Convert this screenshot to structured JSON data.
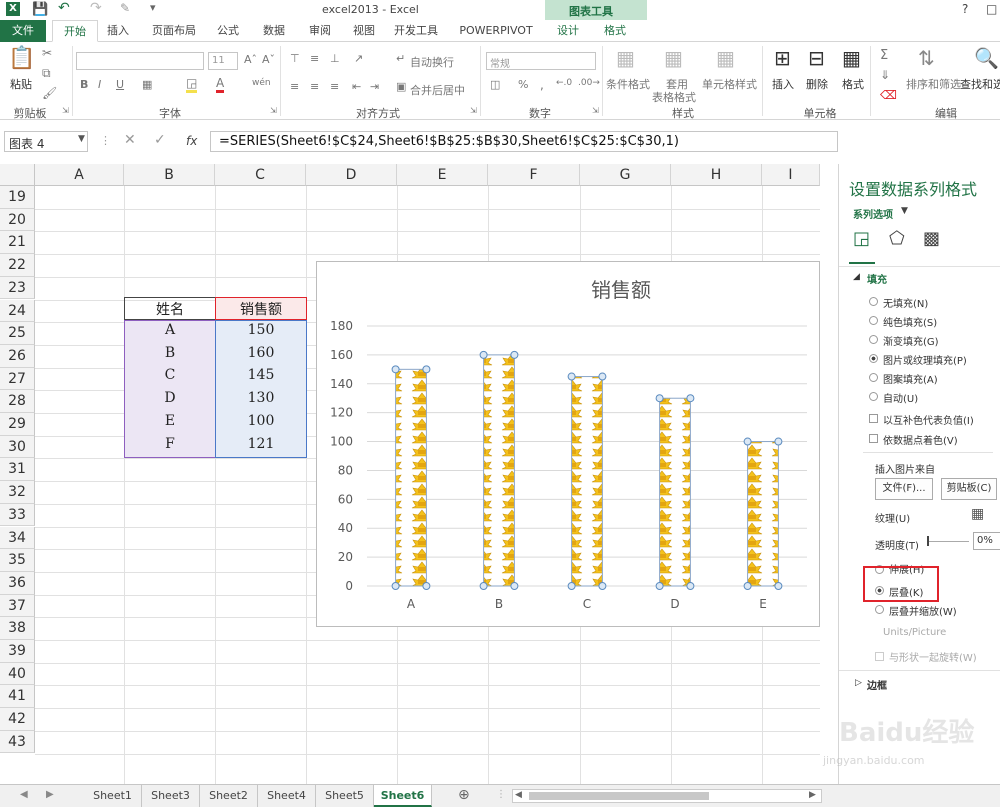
{
  "window": {
    "title": "excel2013 - Excel",
    "context_tab_group": "图表工具",
    "help": "?"
  },
  "ribbon_tabs": [
    "文件",
    "开始",
    "插入",
    "页面布局",
    "公式",
    "数据",
    "审阅",
    "视图",
    "开发工具",
    "POWERPIVOT",
    "设计",
    "格式"
  ],
  "ribbon": {
    "paste": "粘贴",
    "clipboard": "剪贴板",
    "font_size": "11",
    "font_group": "字体",
    "wrap_text": "自动换行",
    "merge_center": "合并后居中",
    "align_group": "对齐方式",
    "number_format": "常规",
    "number_group": "数字",
    "conditional_format": "条件格式",
    "table_format_1": "套用",
    "table_format_2": "表格格式",
    "cell_styles": "单元格样式",
    "styles_group": "样式",
    "insert": "插入",
    "delete": "删除",
    "format": "格式",
    "cells_group": "单元格",
    "sort_filter": "排序和筛选",
    "find_select": "查找和选",
    "editing_group": "编辑"
  },
  "formula_bar": {
    "name_box": "图表 4",
    "fx": "fx",
    "formula": "=SERIES(Sheet6!$C$24,Sheet6!$B$25:$B$30,Sheet6!$C$25:$C$30,1)"
  },
  "columns": [
    "A",
    "B",
    "C",
    "D",
    "E",
    "F",
    "G",
    "H",
    "I"
  ],
  "rows": [
    "19",
    "20",
    "21",
    "22",
    "23",
    "24",
    "25",
    "26",
    "27",
    "28",
    "29",
    "30",
    "31",
    "32",
    "33",
    "34",
    "35",
    "36",
    "37",
    "38",
    "39",
    "40",
    "41",
    "42",
    "43"
  ],
  "table": {
    "header": [
      "姓名",
      "销售额"
    ],
    "rows": [
      [
        "A",
        "150"
      ],
      [
        "B",
        "160"
      ],
      [
        "C",
        "145"
      ],
      [
        "D",
        "130"
      ],
      [
        "E",
        "100"
      ],
      [
        "F",
        "121"
      ]
    ]
  },
  "chart_data": {
    "type": "bar",
    "title": "销售额",
    "categories": [
      "A",
      "B",
      "C",
      "D",
      "E"
    ],
    "series": [
      {
        "name": "销售额",
        "values": [
          150,
          160,
          145,
          130,
          100
        ]
      }
    ],
    "ylim": [
      0,
      180
    ],
    "yticks": [
      "0",
      "20",
      "40",
      "60",
      "80",
      "100",
      "120",
      "140",
      "160",
      "180"
    ],
    "grid": true,
    "fill": "picture-stacked"
  },
  "pane": {
    "title": "设置数据系列格式",
    "series_options": "系列选项",
    "fill_section": "填充",
    "fill_options": [
      "无填充(N)",
      "纯色填充(S)",
      "渐变填充(G)",
      "图片或纹理填充(P)",
      "图案填充(A)",
      "自动(U)"
    ],
    "fill_selected": "图片或纹理填充(P)",
    "invert_if_negative": "以互补色代表负值(I)",
    "vary_colors": "依数据点着色(V)",
    "insert_from": "插入图片来自",
    "file_button": "文件(F)...",
    "clipboard_button": "剪贴板(C)",
    "texture": "纹理(U)",
    "transparency": "透明度(T)",
    "transparency_value": "0%",
    "stretch": "伸展(H)",
    "stack": "层叠(K)",
    "stack_scale": "层叠并缩放(W)",
    "units_picture": "Units/Picture",
    "rotate_with_shape": "与形状一起旋转(W)",
    "border_section": "边框"
  },
  "sheets": [
    "Sheet1",
    "Sheet3",
    "Sheet2",
    "Sheet4",
    "Sheet5",
    "Sheet6"
  ],
  "active_sheet": "Sheet6",
  "watermark": {
    "brand": "Baidu经验",
    "url": "jingyan.baidu.com"
  },
  "colors": {
    "excel_green": "#217346",
    "highlight_red": "#e0232b",
    "table_purple": "#ece6f4",
    "table_blue": "#e5ecf7",
    "bar_gold": "#f4c21b"
  }
}
